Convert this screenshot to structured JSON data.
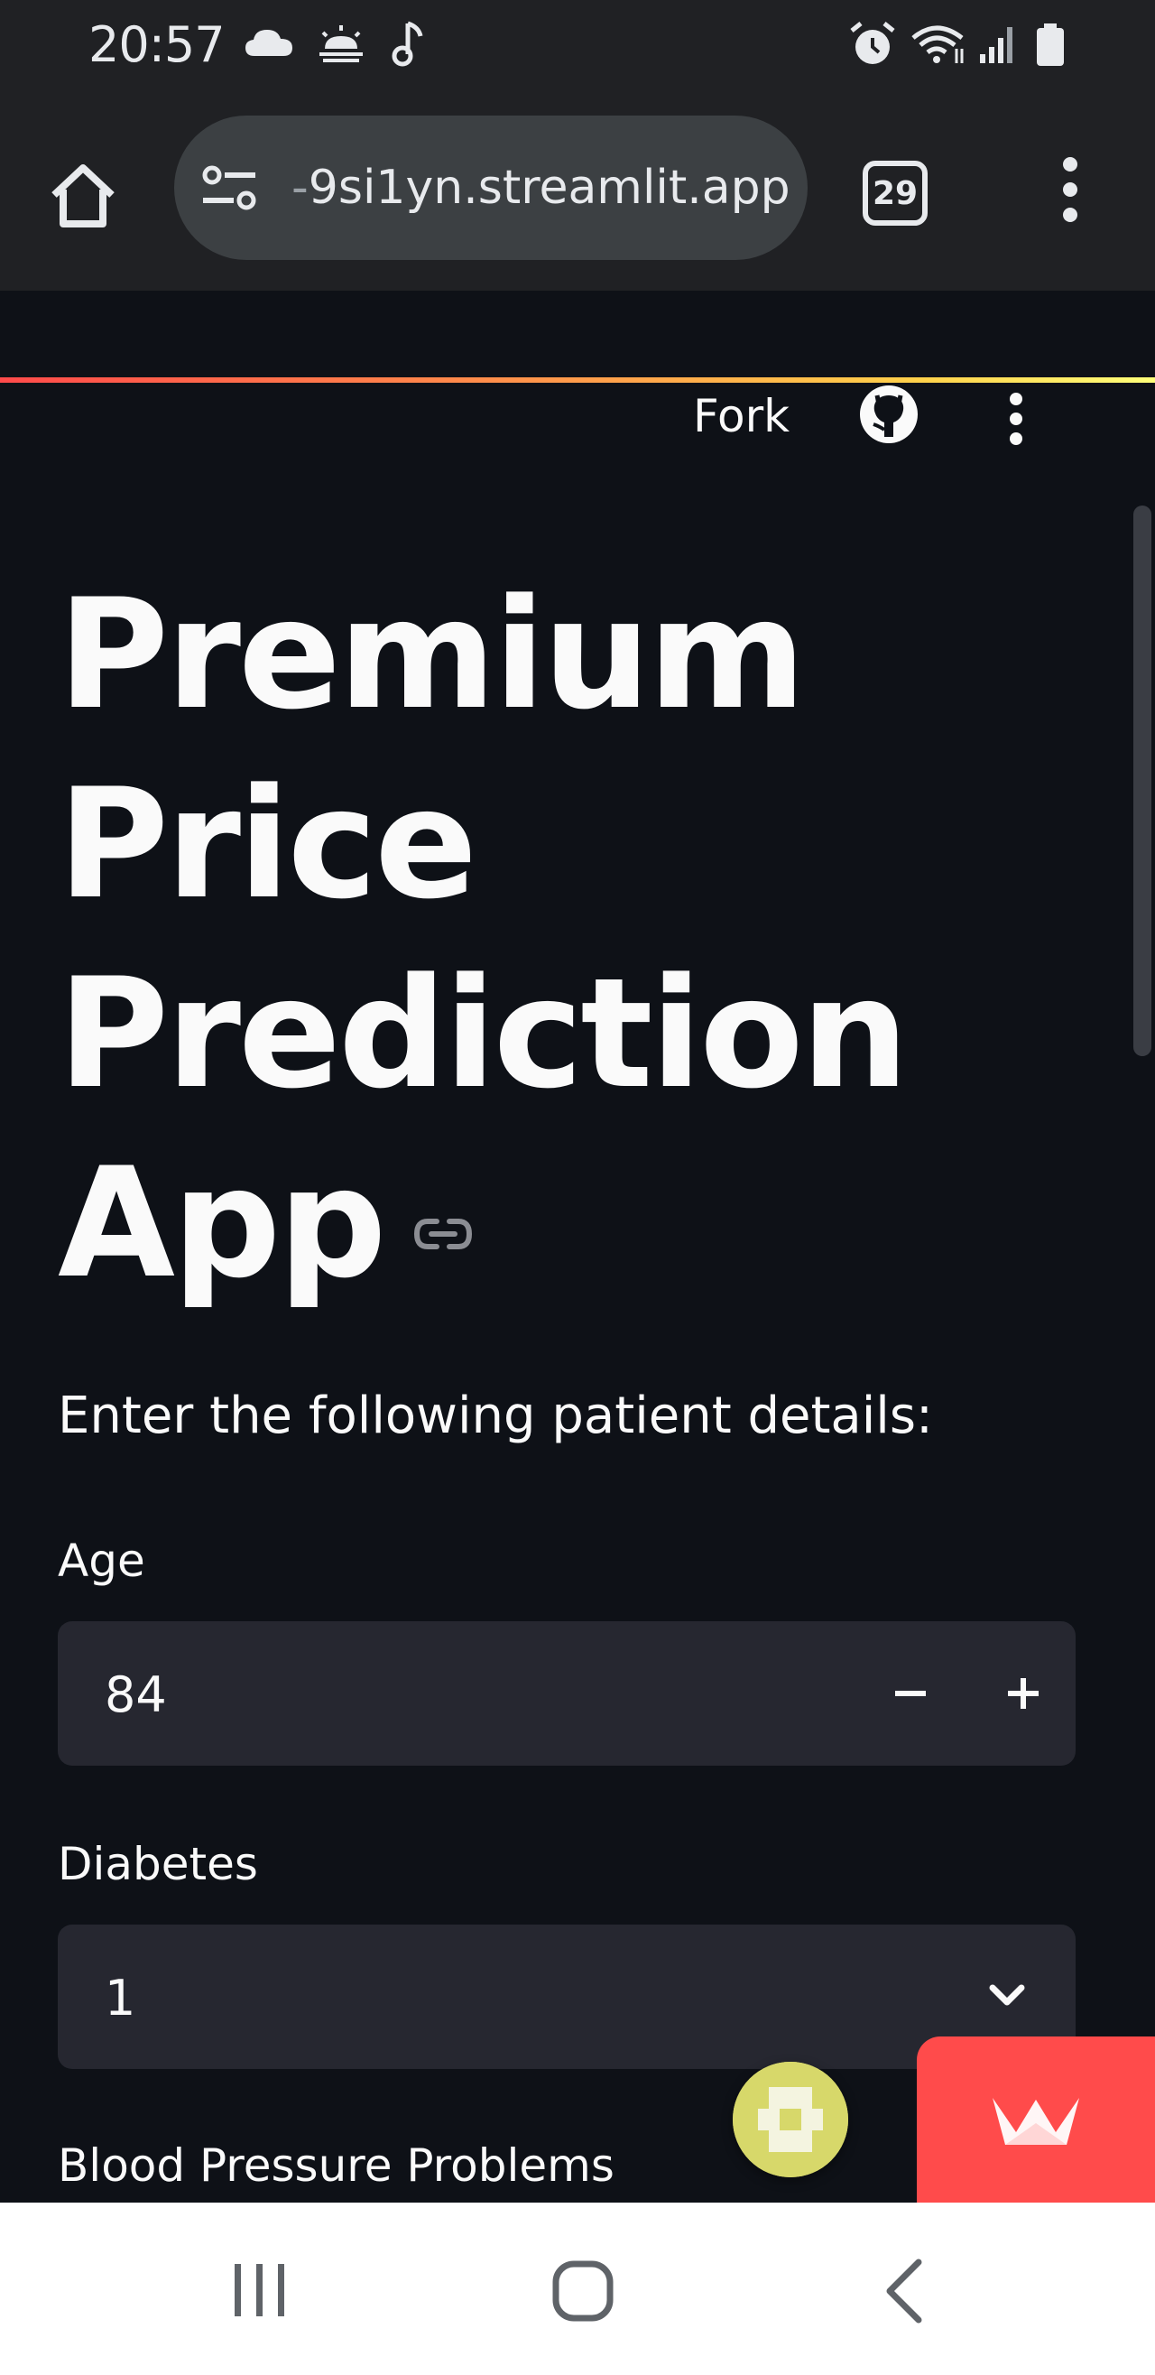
{
  "status_bar": {
    "time": "20:57",
    "left_icons": [
      "cloud-icon",
      "sunrise-icon",
      "music-note-icon"
    ],
    "right_icons": [
      "alarm-icon",
      "wifi-icon",
      "signal-icon",
      "battery-icon"
    ]
  },
  "browser": {
    "url_fade": "-",
    "url": "9si1yn.streamlit.app",
    "tab_count": "29",
    "home_icon": "home-icon",
    "site_info_icon": "site-info-icon",
    "menu_icon": "more-vert-icon"
  },
  "app_header": {
    "fork_label": "Fork",
    "github_icon": "github-icon",
    "menu_icon": "more-vert-icon"
  },
  "main": {
    "title_lines": [
      "Premium",
      "Price",
      "Prediction",
      "App"
    ],
    "subheader": "Enter the following patient details:",
    "fields": [
      {
        "label": "Age",
        "type": "number",
        "value": "84"
      },
      {
        "label": "Diabetes",
        "type": "select",
        "value": "1"
      },
      {
        "label": "Blood Pressure Problems"
      }
    ]
  },
  "colors": {
    "background": "#0e1117",
    "input_bg": "#262730",
    "accent": "#ff4b4b",
    "text": "#fafafa",
    "chrome_bg": "#202124"
  }
}
